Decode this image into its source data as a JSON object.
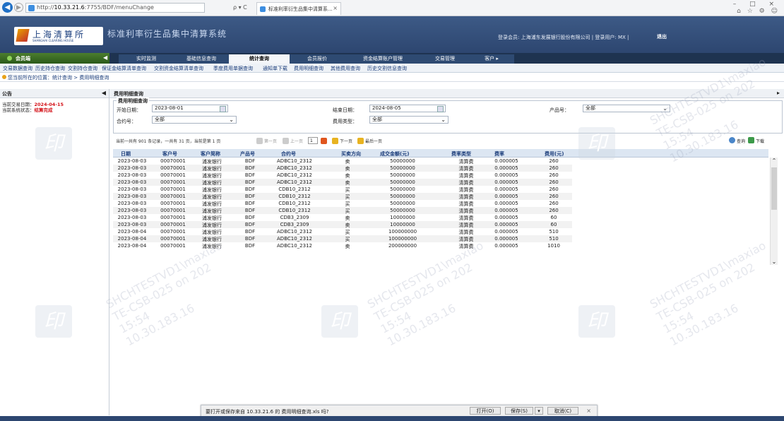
{
  "browser": {
    "url_prefix": "http://",
    "url_host": "10.33.21.6",
    "url_rest": ":7755/BDF/menuChange",
    "search_refresh": "ρ ▾ C",
    "tab_title": "标准利率衍生品集中清算系...",
    "tab_close": "×",
    "window_controls": "– □ ×",
    "toolbar_icons": "⌂ ☆ ⚙ ☺"
  },
  "header": {
    "logo_cn": "上海清算所",
    "logo_en": "SHANGHAI CLEARING HOUSE",
    "system_title": "标准利率衍生品集中清算系统",
    "user_info": "登录会员: 上海浦东发展银行股份有限公司  |  登录用户: MX  |",
    "logout": "退出"
  },
  "nav": {
    "member_label": "会员端",
    "collapse": "◀",
    "tabs": [
      {
        "label": "实时监测"
      },
      {
        "label": "基础信息查询"
      },
      {
        "label": "统计查询"
      },
      {
        "label": "会员报价"
      },
      {
        "label": "资金结算账户管理"
      },
      {
        "label": "交易管理"
      },
      {
        "label": "客户 ▸"
      }
    ]
  },
  "subnav": {
    "items": [
      "交易数据查询",
      "历史持仓查询",
      "交割持仓查询",
      "保证金结算清单查询",
      "交割资金结算清单查询",
      "季度费用单据查询",
      "通知单下载",
      "费用明细查询",
      "其他费用查询",
      "历史交割信息查询"
    ]
  },
  "breadcrumb": "您当前所在的位置：统计查询 > 费用明细查询",
  "left_panel": {
    "title": "公告",
    "collapse": "◀",
    "trade_date_label": "当前交易日期：",
    "trade_date": "2024-04-15",
    "status_label": "当前系统状态：",
    "status": "结算完成"
  },
  "content": {
    "title": "费用明细查询",
    "collapse": "▸",
    "form": {
      "legend": "费用明细查询",
      "start_label": "开始日期：",
      "start_value": "2023-08-01",
      "end_label": "结束日期：",
      "end_value": "2024-08-05",
      "product_label": "产品号：",
      "product_value": "全部",
      "contract_label": "合约号：",
      "contract_value": "全部",
      "fee_type_label": "费用类型：",
      "fee_type_value": "全部"
    },
    "toolbar": {
      "summary": "当前一共有  901  条记录，一共有  31  页，当前是第  1  页",
      "first": "第一页",
      "prev": "上一页",
      "page": "1",
      "next": "下一页",
      "last": "最后一页",
      "query": "查询",
      "download": "下载"
    },
    "table": {
      "columns": [
        "日期",
        "客户号",
        "客户简称",
        "产品号",
        "合约号",
        "买卖方向",
        "成交金额(元)",
        "费率类型",
        "费率",
        "费用(元)"
      ],
      "rows": [
        [
          "2023-08-03",
          "00070001",
          "浦发银行",
          "BDF",
          "ADBC10_2312",
          "卖",
          "50000000",
          "清算费",
          "0.000005",
          "260"
        ],
        [
          "2023-08-03",
          "00070001",
          "浦发银行",
          "BDF",
          "ADBC10_2312",
          "卖",
          "50000000",
          "清算费",
          "0.000005",
          "260"
        ],
        [
          "2023-08-03",
          "00070001",
          "浦发银行",
          "BDF",
          "ADBC10_2312",
          "卖",
          "50000000",
          "清算费",
          "0.000005",
          "260"
        ],
        [
          "2023-08-03",
          "00070001",
          "浦发银行",
          "BDF",
          "ADBC10_2312",
          "卖",
          "50000000",
          "清算费",
          "0.000005",
          "260"
        ],
        [
          "2023-08-03",
          "00070001",
          "浦发银行",
          "BDF",
          "CDB10_2312",
          "买",
          "50000000",
          "清算费",
          "0.000005",
          "260"
        ],
        [
          "2023-08-03",
          "00070001",
          "浦发银行",
          "BDF",
          "CDB10_2312",
          "买",
          "50000000",
          "清算费",
          "0.000005",
          "260"
        ],
        [
          "2023-08-03",
          "00070001",
          "浦发银行",
          "BDF",
          "CDB10_2312",
          "买",
          "50000000",
          "清算费",
          "0.000005",
          "260"
        ],
        [
          "2023-08-03",
          "00070001",
          "浦发银行",
          "BDF",
          "CDB10_2312",
          "买",
          "50000000",
          "清算费",
          "0.000005",
          "260"
        ],
        [
          "2023-08-03",
          "00070001",
          "浦发银行",
          "BDF",
          "CDB3_2309",
          "卖",
          "10000000",
          "清算费",
          "0.000005",
          "60"
        ],
        [
          "2023-08-03",
          "00070001",
          "浦发银行",
          "BDF",
          "CDB3_2309",
          "卖",
          "10000000",
          "清算费",
          "0.000005",
          "60"
        ],
        [
          "2023-08-04",
          "00070001",
          "浦发银行",
          "BDF",
          "ADBC10_2312",
          "买",
          "100000000",
          "清算费",
          "0.000005",
          "510"
        ],
        [
          "2023-08-04",
          "00070001",
          "浦发银行",
          "BDF",
          "ADBC10_2312",
          "买",
          "100000000",
          "清算费",
          "0.000005",
          "510"
        ],
        [
          "2023-08-04",
          "00070001",
          "浦发银行",
          "BDF",
          "ADBC10_2312",
          "卖",
          "200000000",
          "清算费",
          "0.000005",
          "1010"
        ]
      ]
    }
  },
  "download_bar": {
    "message": "要打开或保存来自 10.33.21.6 的 费用明细查询.xls 吗?",
    "open": "打开(O)",
    "save": "保存(S)",
    "dropdown": "▾",
    "cancel": "取消(C)",
    "close": "×"
  },
  "watermarks": {
    "line1": "SHCHTESTVD1\\maxiao",
    "line2": "TE-CSB-025 on 202",
    "line3": "15:54",
    "line4": "10.30.183.16",
    "stamp": "印"
  },
  "colors": {
    "header_bg": "#2d4670",
    "nav_bg": "#1e3350",
    "member_green": "#3e7428",
    "link_blue": "#1a3c7a",
    "alert_red": "#d4141b"
  }
}
